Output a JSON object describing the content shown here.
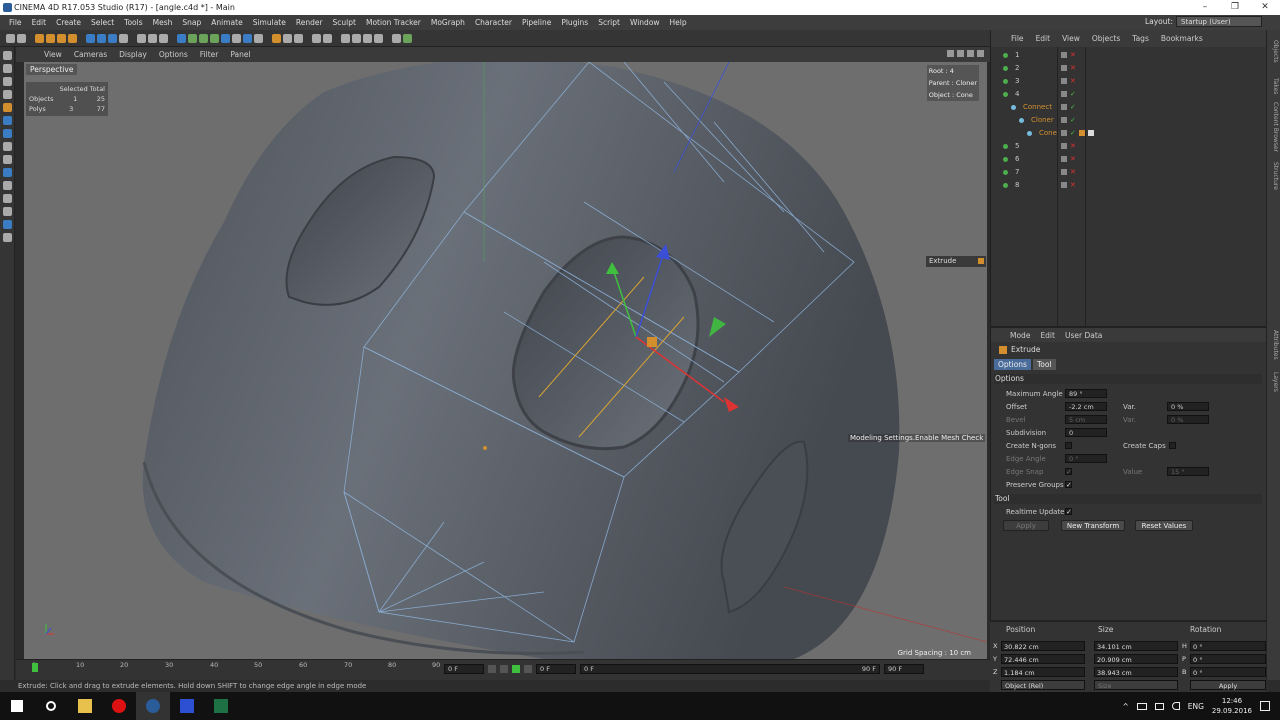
{
  "window": {
    "title": "CINEMA 4D R17.053 Studio (R17) - [angle.c4d *] - Main",
    "controls": [
      "–",
      "❐",
      "✕"
    ]
  },
  "menubar": {
    "items": [
      "File",
      "Edit",
      "Create",
      "Select",
      "Tools",
      "Mesh",
      "Snap",
      "Animate",
      "Simulate",
      "Render",
      "Sculpt",
      "Motion Tracker",
      "MoGraph",
      "Character",
      "Pipeline",
      "Plugins",
      "Script",
      "Window",
      "Help"
    ],
    "layout_label": "Layout:",
    "layout_value": "Startup (User)"
  },
  "viewport": {
    "menu": [
      "View",
      "Cameras",
      "Display",
      "Options",
      "Filter",
      "Panel"
    ],
    "camera_label": "Perspective",
    "stats": {
      "header": "Selected Total",
      "objects_label": "Objects",
      "objects_selected": "1",
      "objects_total": "25",
      "polys_label": "Polys",
      "polys_selected": "3",
      "polys_total": "77"
    },
    "info": {
      "root": "Root : 4",
      "parent": "Parent : Cloner",
      "object": "Object : Cone"
    },
    "grid_spacing": "Grid Spacing : 10 cm",
    "hud_label": "Extrude",
    "tooltip": "Modeling Settings.Enable Mesh Check"
  },
  "timeline": {
    "ticks": [
      "0",
      "10",
      "20",
      "30",
      "40",
      "50",
      "60",
      "70",
      "80",
      "90"
    ],
    "current_frame": "0 F",
    "start_frame": "0 F",
    "min_frame": "0 F",
    "max_frame": "90 F",
    "end_frame": "90 F"
  },
  "statusbar": {
    "text": "Extrude: Click and drag to extrude elements. Hold down SHIFT to change edge angle in edge mode"
  },
  "objects": {
    "menu": [
      "File",
      "Edit",
      "View",
      "Objects",
      "Tags",
      "Bookmarks"
    ],
    "rows": [
      {
        "name": "1",
        "color": "#c8c8c8"
      },
      {
        "name": "2",
        "color": "#c8c8c8"
      },
      {
        "name": "3",
        "color": "#c8c8c8"
      },
      {
        "name": "4",
        "color": "#c8c8c8"
      },
      {
        "name": "Connect",
        "color": "#d38f2d"
      },
      {
        "name": "Cloner",
        "color": "#d38f2d"
      },
      {
        "name": "Cone",
        "color": "#d38f2d"
      },
      {
        "name": "5",
        "color": "#c8c8c8"
      },
      {
        "name": "6",
        "color": "#c8c8c8"
      },
      {
        "name": "7",
        "color": "#c8c8c8"
      },
      {
        "name": "8",
        "color": "#c8c8c8"
      }
    ]
  },
  "attributes": {
    "menu": [
      "Mode",
      "Edit",
      "User Data"
    ],
    "title": "Extrude",
    "tabs": [
      "Options",
      "Tool"
    ],
    "section_options": "Options",
    "max_angle_label": "Maximum Angle",
    "max_angle_value": "89 °",
    "offset_label": "Offset",
    "offset_value": "-2.2 cm",
    "var_label": "Var.",
    "var_value": "0 %",
    "bevel_label": "Bevel",
    "bevel_value": "5 cm",
    "var2_label": "Var.",
    "var2_value": "0 %",
    "subdivision_label": "Subdivision",
    "subdivision_value": "0",
    "create_ngons_label": "Create N-gons",
    "create_caps_label": "Create Caps",
    "edge_angle_label": "Edge Angle",
    "edge_angle_value": "0 °",
    "edge_snap_label": "Edge Snap",
    "value_label": "Value",
    "value_value": "15 °",
    "preserve_groups_label": "Preserve Groups",
    "section_tool": "Tool",
    "realtime_update_label": "Realtime Update",
    "apply_label": "Apply",
    "new_transform_label": "New Transform",
    "reset_values_label": "Reset Values"
  },
  "coordinates": {
    "position_header": "Position",
    "size_header": "Size",
    "rotation_header": "Rotation",
    "x": {
      "axis": "X",
      "pos": "30.822 cm",
      "size": "34.101 cm",
      "rot_axis": "H",
      "rot": "0 °"
    },
    "y": {
      "axis": "Y",
      "pos": "72.446 cm",
      "size": "20.909 cm",
      "rot_axis": "P",
      "rot": "0 °"
    },
    "z": {
      "axis": "Z",
      "pos": "1.184 cm",
      "size": "38.943 cm",
      "rot_axis": "B",
      "rot": "0 °"
    },
    "mode": "Object (Rel)",
    "size_mode": "Size",
    "apply": "Apply"
  },
  "sidetabs": [
    "Objects",
    "Takes",
    "Content Browser",
    "Structure",
    "Attributes",
    "Layers"
  ],
  "taskbar": {
    "lang": "ENG",
    "time": "12:46",
    "date": "29.09.2016"
  }
}
